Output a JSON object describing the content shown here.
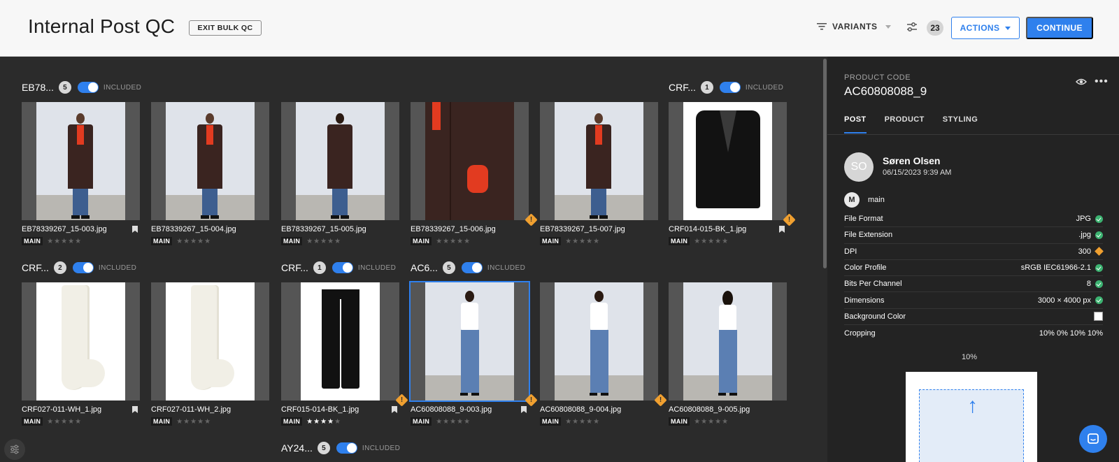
{
  "header": {
    "title": "Internal Post QC",
    "exit_label": "EXIT BULK QC",
    "variants_label": "VARIANTS",
    "count": "23",
    "actions_label": "ACTIONS",
    "continue_label": "CONTINUE"
  },
  "groups": [
    {
      "name": "EB78...",
      "count": "5",
      "status": "INCLUDED"
    },
    {
      "name": "CRF...",
      "count": "1",
      "status": "INCLUDED"
    },
    {
      "name": "CRF...",
      "count": "2",
      "status": "INCLUDED"
    },
    {
      "name": "CRF...",
      "count": "1",
      "status": "INCLUDED"
    },
    {
      "name": "AC6...",
      "count": "5",
      "status": "INCLUDED"
    },
    {
      "name": "AY24...",
      "count": "5",
      "status": "INCLUDED"
    }
  ],
  "images": [
    {
      "file": "EB78339267_15-003.jpg",
      "tag": "MAIN",
      "rating": 0,
      "bookmark": true,
      "warning": false
    },
    {
      "file": "EB78339267_15-004.jpg",
      "tag": "MAIN",
      "rating": 0,
      "bookmark": false,
      "warning": false
    },
    {
      "file": "EB78339267_15-005.jpg",
      "tag": "MAIN",
      "rating": 0,
      "bookmark": false,
      "warning": false
    },
    {
      "file": "EB78339267_15-006.jpg",
      "tag": "MAIN",
      "rating": 0,
      "bookmark": false,
      "warning": true
    },
    {
      "file": "EB78339267_15-007.jpg",
      "tag": "MAIN",
      "rating": 0,
      "bookmark": false,
      "warning": false
    },
    {
      "file": "CRF014-015-BK_1.jpg",
      "tag": "MAIN",
      "rating": 0,
      "bookmark": true,
      "warning": true
    },
    {
      "file": "CRF027-011-WH_1.jpg",
      "tag": "MAIN",
      "rating": 0,
      "bookmark": true,
      "warning": false
    },
    {
      "file": "CRF027-011-WH_2.jpg",
      "tag": "MAIN",
      "rating": 0,
      "bookmark": false,
      "warning": false
    },
    {
      "file": "CRF015-014-BK_1.jpg",
      "tag": "MAIN",
      "rating": 4,
      "bookmark": true,
      "warning": true
    },
    {
      "file": "AC60808088_9-003.jpg",
      "tag": "MAIN",
      "rating": 0,
      "bookmark": true,
      "warning": true
    },
    {
      "file": "AC60808088_9-004.jpg",
      "tag": "MAIN",
      "rating": 0,
      "bookmark": false,
      "warning": true
    },
    {
      "file": "AC60808088_9-005.jpg",
      "tag": "MAIN",
      "rating": 0,
      "bookmark": false,
      "warning": false
    }
  ],
  "panel": {
    "code_label": "PRODUCT CODE",
    "code": "AC60808088_9",
    "tabs": [
      "POST",
      "PRODUCT",
      "STYLING"
    ],
    "user_initials": "SO",
    "user_name": "Søren Olsen",
    "user_date": "06/15/2023 9:39 AM",
    "variant_badge": "M",
    "variant_label": "main",
    "properties": [
      {
        "label": "File Format",
        "value": "JPG",
        "status": "ok"
      },
      {
        "label": "File Extension",
        "value": ".jpg",
        "status": "ok"
      },
      {
        "label": "DPI",
        "value": "300",
        "status": "warning"
      },
      {
        "label": "Color Profile",
        "value": "sRGB IEC61966-2.1",
        "status": "ok"
      },
      {
        "label": "Bits Per Channel",
        "value": "8",
        "status": "ok"
      },
      {
        "label": "Dimensions",
        "value": "3000 × 4000 px",
        "status": "ok"
      },
      {
        "label": "Background Color",
        "value": "",
        "status": "swatch"
      },
      {
        "label": "Cropping",
        "value": "10% 0% 10% 10%",
        "status": "none"
      }
    ],
    "crop_top_label": "10%"
  },
  "colors": {
    "accent": "#2f80ed",
    "warning": "#f0a030",
    "ok": "#3cb371",
    "panel_bg": "#232323",
    "grid_bg": "#2b2b2b"
  }
}
